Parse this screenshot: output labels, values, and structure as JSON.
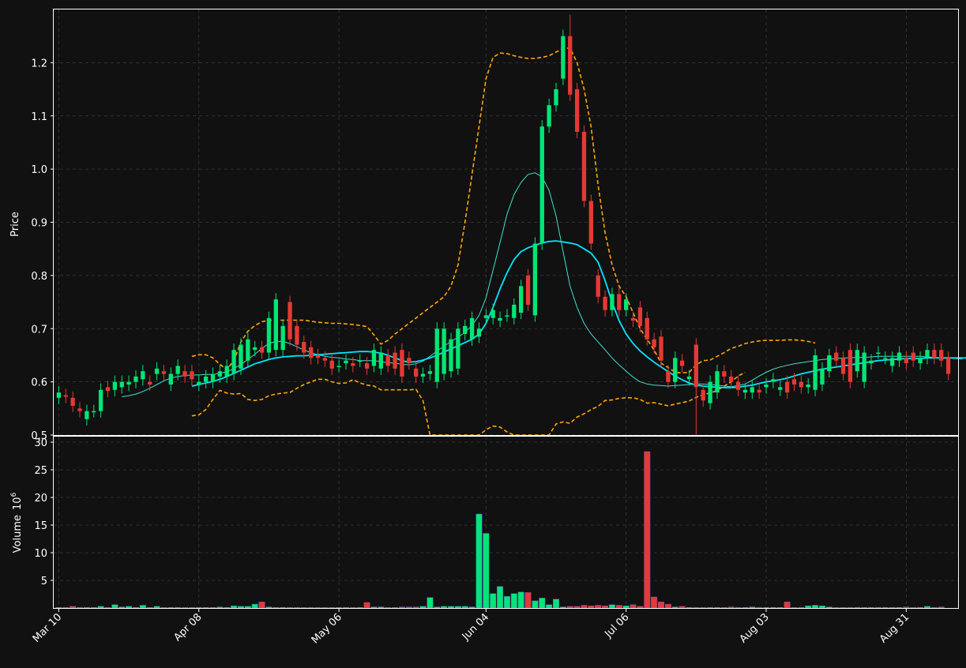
{
  "chart_data": {
    "type": "candlestick",
    "ylabel_price": "Price",
    "ylabel_volume": "Volume",
    "volume_exponent": "10",
    "volume_exponent_power": "6",
    "price_ylim": [
      0.5,
      1.3
    ],
    "price_yticks": [
      "0.5",
      "0.6",
      "0.7",
      "0.8",
      "0.9",
      "1.0",
      "1.1",
      "1.2"
    ],
    "volume_ylim": [
      0,
      31
    ],
    "volume_yticks": [
      "5",
      "10",
      "15",
      "20",
      "25",
      "30"
    ],
    "x_ticks": [
      {
        "label": "Mar 10",
        "i": 0
      },
      {
        "label": "Apr 08",
        "i": 20
      },
      {
        "label": "May 06",
        "i": 40
      },
      {
        "label": "Jun 04",
        "i": 61
      },
      {
        "label": "Jul 06",
        "i": 81
      },
      {
        "label": "Aug 03",
        "i": 101
      },
      {
        "label": "Aug 31",
        "i": 121
      }
    ],
    "grid": true,
    "colors": {
      "up": "#00e676",
      "down": "#e53935",
      "background": "#111111",
      "bollinger": "#ffa500",
      "ma_long": "#00e5ff",
      "ma_short": "#40e0d0",
      "grid": "#3a3a3a"
    },
    "series": {
      "open": [
        0.57,
        0.575,
        0.57,
        0.55,
        0.53,
        0.545,
        0.545,
        0.59,
        0.585,
        0.59,
        0.595,
        0.6,
        0.605,
        0.6,
        0.615,
        0.62,
        0.595,
        0.615,
        0.62,
        0.62,
        0.595,
        0.6,
        0.6,
        0.61,
        0.61,
        0.615,
        0.625,
        0.64,
        0.66,
        0.665,
        0.655,
        0.66,
        0.66,
        0.75,
        0.705,
        0.675,
        0.665,
        0.65,
        0.645,
        0.64,
        0.63,
        0.635,
        0.635,
        0.64,
        0.635,
        0.63,
        0.625,
        0.65,
        0.655,
        0.66,
        0.645,
        0.625,
        0.61,
        0.615,
        0.6,
        0.615,
        0.62,
        0.625,
        0.69,
        0.68,
        0.685,
        0.72,
        0.72,
        0.715,
        0.725,
        0.72,
        0.73,
        0.8,
        0.725,
        0.86,
        1.08,
        1.12,
        1.17,
        1.25,
        1.15,
        1.07,
        0.94,
        0.8,
        0.76,
        0.735,
        0.765,
        0.735,
        0.72,
        0.74,
        0.72,
        0.68,
        0.685,
        0.62,
        0.6,
        0.64,
        0.605,
        0.67,
        0.585,
        0.56,
        0.58,
        0.62,
        0.61,
        0.6,
        0.58,
        0.58,
        0.585,
        0.59,
        0.6,
        0.585,
        0.6,
        0.605,
        0.6,
        0.59,
        0.585,
        0.595,
        0.62,
        0.655,
        0.645,
        0.66,
        0.62,
        0.6,
        0.635,
        0.655,
        0.645,
        0.63,
        0.64,
        0.645,
        0.655,
        0.635,
        0.645,
        0.66,
        0.66,
        0.645,
        0.64
      ],
      "close": [
        0.58,
        0.572,
        0.555,
        0.545,
        0.545,
        0.545,
        0.585,
        0.583,
        0.6,
        0.6,
        0.6,
        0.61,
        0.62,
        0.595,
        0.625,
        0.615,
        0.615,
        0.63,
        0.61,
        0.605,
        0.6,
        0.61,
        0.615,
        0.62,
        0.63,
        0.66,
        0.67,
        0.68,
        0.665,
        0.655,
        0.72,
        0.755,
        0.705,
        0.68,
        0.67,
        0.655,
        0.645,
        0.645,
        0.64,
        0.625,
        0.63,
        0.64,
        0.63,
        0.64,
        0.625,
        0.66,
        0.655,
        0.63,
        0.625,
        0.61,
        0.635,
        0.61,
        0.615,
        0.62,
        0.7,
        0.7,
        0.68,
        0.7,
        0.705,
        0.72,
        0.7,
        0.725,
        0.735,
        0.72,
        0.725,
        0.745,
        0.78,
        0.745,
        0.86,
        1.08,
        1.12,
        1.15,
        1.25,
        1.14,
        1.07,
        0.94,
        0.86,
        0.76,
        0.735,
        0.765,
        0.735,
        0.755,
        0.715,
        0.705,
        0.68,
        0.665,
        0.64,
        0.6,
        0.645,
        0.63,
        0.61,
        0.59,
        0.565,
        0.6,
        0.62,
        0.61,
        0.6,
        0.585,
        0.585,
        0.59,
        0.58,
        0.595,
        0.605,
        0.59,
        0.58,
        0.595,
        0.59,
        0.595,
        0.65,
        0.625,
        0.65,
        0.64,
        0.615,
        0.6,
        0.66,
        0.655,
        0.64,
        0.655,
        0.645,
        0.645,
        0.655,
        0.635,
        0.64,
        0.645,
        0.66,
        0.645,
        0.64,
        0.615
      ],
      "volume": [
        0.1,
        0.1,
        0.3,
        0.1,
        0.1,
        0.1,
        0.3,
        0.1,
        0.6,
        0.2,
        0.3,
        0.1,
        0.5,
        0.1,
        0.3,
        0.1,
        0.1,
        0.1,
        0.1,
        0.1,
        0.1,
        0.1,
        0.1,
        0.2,
        0.1,
        0.4,
        0.3,
        0.3,
        0.7,
        1.1,
        0.2,
        0.1,
        0.1,
        0.1,
        0.1,
        0.1,
        0.1,
        0.1,
        0.1,
        0.1,
        0.1,
        0.1,
        0.1,
        0.1,
        1.0,
        0.2,
        0.2,
        0.1,
        0.1,
        0.2,
        0.2,
        0.2,
        0.3,
        1.9,
        0.2,
        0.3,
        0.3,
        0.3,
        0.3,
        0.2,
        17.0,
        13.5,
        2.6,
        3.9,
        2.1,
        2.6,
        2.9,
        2.8,
        1.3,
        1.8,
        0.6,
        1.6,
        0.2,
        0.3,
        0.3,
        0.5,
        0.4,
        0.5,
        0.4,
        0.6,
        0.5,
        0.4,
        0.6,
        0.3,
        28.3,
        2.0,
        1.1,
        0.7,
        0.2,
        0.3,
        0.1,
        0.1,
        0.1,
        0.1,
        0.1,
        0.1,
        0.2,
        0.1,
        0.1,
        0.2,
        0.1,
        0.1,
        0.1,
        0.1,
        1.1,
        0.1,
        0.1,
        0.4,
        0.5,
        0.4,
        0.2,
        0.1,
        0.1,
        0.1,
        0.1,
        0.1,
        0.1,
        0.1,
        0.1,
        0.1,
        0.1,
        0.2,
        0.1,
        0.1,
        0.3,
        0.1,
        0.2
      ],
      "ma_long": [
        null,
        null,
        null,
        null,
        null,
        null,
        null,
        null,
        null,
        null,
        null,
        null,
        null,
        null,
        null,
        null,
        null,
        null,
        null,
        0.592,
        0.595,
        0.598,
        0.601,
        0.605,
        0.61,
        0.616,
        0.622,
        0.628,
        0.634,
        0.638,
        0.642,
        0.645,
        0.647,
        0.648,
        0.649,
        0.649,
        0.65,
        0.651,
        0.652,
        0.653,
        0.654,
        0.655,
        0.656,
        0.657,
        0.657,
        0.656,
        0.654,
        0.65,
        0.645,
        0.64,
        0.637,
        0.638,
        0.641,
        0.645,
        0.65,
        0.656,
        0.662,
        0.668,
        0.674,
        0.68,
        0.69,
        0.71,
        0.74,
        0.775,
        0.805,
        0.83,
        0.845,
        0.852,
        0.857,
        0.861,
        0.864,
        0.865,
        0.863,
        0.861,
        0.858,
        0.85,
        0.842,
        0.825,
        0.79,
        0.75,
        0.715,
        0.69,
        0.672,
        0.658,
        0.647,
        0.637,
        0.628,
        0.619,
        0.611,
        0.604,
        0.598,
        0.594,
        0.592,
        0.591,
        0.59,
        0.589,
        0.589,
        0.59,
        0.592,
        0.594,
        0.597,
        0.6,
        0.602,
        0.604,
        0.607,
        0.611,
        0.615,
        0.618,
        0.621,
        0.624,
        0.626,
        0.628,
        0.63,
        0.632,
        0.634,
        0.636,
        0.638,
        0.64,
        0.641,
        0.642,
        0.643,
        0.644,
        0.644,
        0.644,
        0.645,
        0.645,
        0.645,
        0.645,
        0.645,
        0.645,
        0.645,
        0.645
      ],
      "ma_short": [
        null,
        null,
        null,
        null,
        null,
        null,
        null,
        null,
        null,
        0.572,
        0.574,
        0.577,
        0.582,
        0.588,
        0.595,
        0.602,
        0.607,
        0.61,
        0.612,
        0.613,
        0.613,
        0.614,
        0.614,
        0.616,
        0.619,
        0.625,
        0.633,
        0.642,
        0.652,
        0.663,
        0.672,
        0.676,
        0.676,
        0.672,
        0.666,
        0.66,
        0.655,
        0.651,
        0.648,
        0.646,
        0.645,
        0.643,
        0.642,
        0.64,
        0.64,
        0.64,
        0.638,
        0.636,
        0.635,
        0.633,
        0.632,
        0.634,
        0.639,
        0.648,
        0.658,
        0.667,
        0.676,
        0.684,
        0.693,
        0.706,
        0.725,
        0.758,
        0.81,
        0.862,
        0.915,
        0.952,
        0.975,
        0.99,
        0.993,
        0.985,
        0.96,
        0.912,
        0.845,
        0.78,
        0.74,
        0.71,
        0.69,
        0.675,
        0.66,
        0.645,
        0.632,
        0.62,
        0.609,
        0.6,
        0.596,
        0.594,
        0.593,
        0.592,
        0.593,
        0.594,
        0.595,
        0.596,
        0.596,
        0.595,
        0.594,
        0.592,
        0.591,
        0.593,
        0.596,
        0.603,
        0.611,
        0.618,
        0.624,
        0.628,
        0.631,
        0.634,
        0.636,
        0.638,
        0.64,
        0.642,
        0.643,
        0.644,
        0.645,
        0.645,
        0.646,
        0.646,
        0.647,
        0.648,
        0.648,
        0.648,
        0.648,
        0.648,
        0.648,
        0.648,
        0.647,
        0.646,
        0.645,
        0.645,
        0.644,
        0.643
      ],
      "bb_upper": [
        null,
        null,
        null,
        null,
        null,
        null,
        null,
        null,
        null,
        null,
        null,
        null,
        null,
        null,
        null,
        null,
        null,
        null,
        null,
        0.648,
        0.651,
        0.651,
        0.645,
        0.633,
        0.623,
        0.64,
        0.675,
        0.695,
        0.706,
        0.713,
        0.716,
        0.716,
        0.716,
        0.716,
        0.716,
        0.716,
        0.714,
        0.712,
        0.711,
        0.71,
        0.71,
        0.709,
        0.708,
        0.706,
        0.704,
        0.688,
        0.671,
        0.678,
        0.69,
        0.7,
        0.71,
        0.72,
        0.73,
        0.74,
        0.75,
        0.76,
        0.78,
        0.82,
        0.9,
        0.99,
        1.08,
        1.17,
        1.21,
        1.218,
        1.217,
        1.213,
        1.21,
        1.208,
        1.208,
        1.21,
        1.213,
        1.22,
        1.226,
        1.228,
        1.2,
        1.15,
        1.08,
        0.97,
        0.88,
        0.82,
        0.78,
        0.76,
        0.73,
        0.7,
        0.68,
        0.66,
        0.635,
        0.627,
        0.618,
        0.617,
        0.618,
        0.632,
        0.64,
        0.641,
        0.648,
        0.655,
        0.663,
        0.667,
        0.672,
        0.675,
        0.677,
        0.678,
        0.678,
        0.678,
        0.679,
        0.679,
        0.678,
        0.676,
        0.673
      ],
      "bb_lower": [
        null,
        null,
        null,
        null,
        null,
        null,
        null,
        null,
        null,
        null,
        null,
        null,
        null,
        null,
        null,
        null,
        null,
        null,
        null,
        0.536,
        0.538,
        0.548,
        0.567,
        0.584,
        0.579,
        0.577,
        0.578,
        0.567,
        0.565,
        0.567,
        0.574,
        0.577,
        0.579,
        0.58,
        0.588,
        0.595,
        0.6,
        0.605,
        0.605,
        0.6,
        0.597,
        0.598,
        0.604,
        0.598,
        0.594,
        0.592,
        0.585,
        0.585,
        0.585,
        0.585,
        0.585,
        0.586,
        0.565,
        0.5,
        0.45,
        0.4,
        0.38,
        0.36,
        0.39,
        0.43,
        0.49,
        0.51,
        0.517,
        0.515,
        0.506,
        0.497,
        0.47,
        0.43,
        0.42,
        0.46,
        0.5,
        0.521,
        0.525,
        0.522,
        0.534,
        0.54,
        0.548,
        0.554,
        0.565,
        0.566,
        0.569,
        0.57,
        0.57,
        0.567,
        0.56,
        0.561,
        0.558,
        0.555,
        0.558,
        0.561,
        0.564,
        0.571,
        0.576,
        0.579,
        0.584,
        0.592,
        0.6,
        0.611,
        0.618
      ]
    }
  }
}
